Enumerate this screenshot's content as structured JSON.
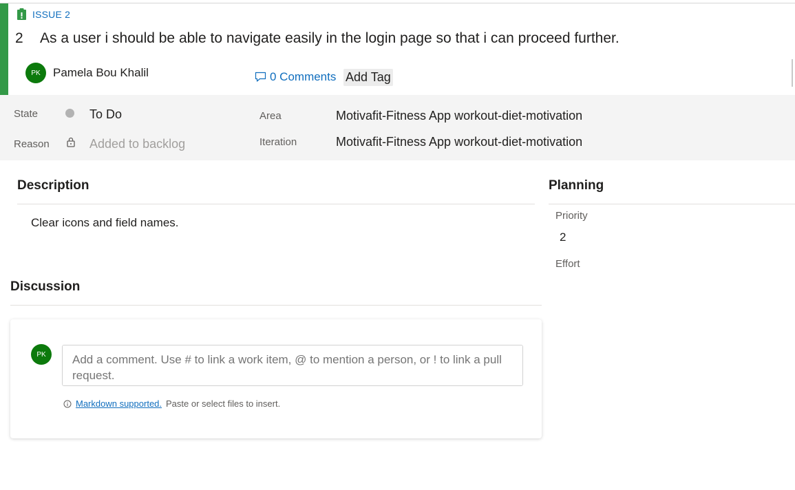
{
  "issue": {
    "type_label": "ISSUE 2",
    "id": "2",
    "title": "As a user i should be able to navigate easily in the login page so that i can proceed further."
  },
  "assignee": {
    "initials": "PK",
    "name": "Pamela Bou Khalil"
  },
  "comments": {
    "label": "0 Comments"
  },
  "tags": {
    "add_label": "Add Tag"
  },
  "fields": {
    "state": {
      "label": "State",
      "value": "To Do"
    },
    "reason": {
      "label": "Reason",
      "value": "Added to backlog"
    },
    "area": {
      "label": "Area",
      "value": "Motivafit-Fitness App workout-diet-motivation"
    },
    "iteration": {
      "label": "Iteration",
      "value": "Motivafit-Fitness App workout-diet-motivation"
    }
  },
  "description": {
    "title": "Description",
    "text": "Clear icons and field names."
  },
  "planning": {
    "title": "Planning",
    "priority_label": "Priority",
    "priority_value": "2",
    "effort_label": "Effort"
  },
  "discussion": {
    "title": "Discussion",
    "avatar_initials": "PK",
    "placeholder": "Add a comment. Use # to link a work item, @ to mention a person, or ! to link a pull request.",
    "markdown_link": "Markdown supported.",
    "markdown_note": "Paste or select files to insert."
  },
  "colors": {
    "accent_green": "#339947",
    "link_blue": "#106ebe",
    "avatar_green": "#0c7a0c",
    "state_todo": "#b2b2b2"
  },
  "icons": [
    "work-item-icon",
    "comment-icon",
    "lock-icon",
    "info-icon"
  ]
}
